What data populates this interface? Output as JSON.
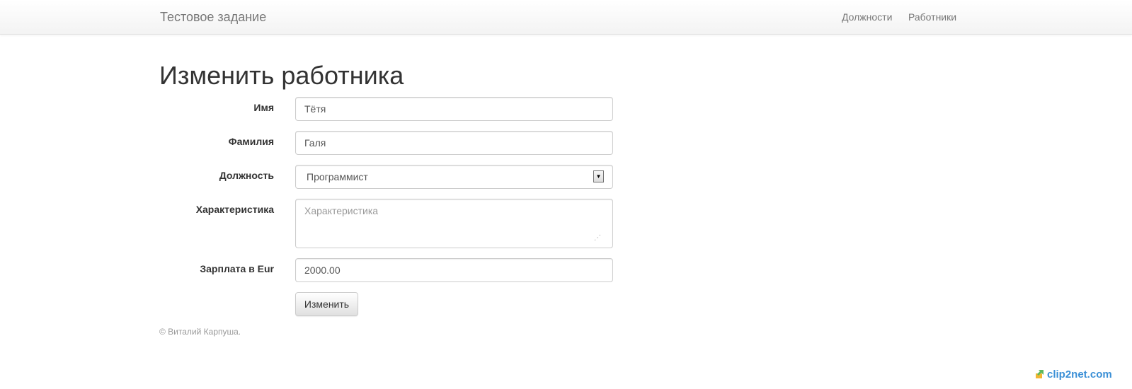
{
  "navbar": {
    "brand": "Тестовое задание",
    "links": [
      {
        "label": "Должности"
      },
      {
        "label": "Работники"
      }
    ]
  },
  "page": {
    "title": "Изменить работника"
  },
  "form": {
    "first_name": {
      "label": "Имя",
      "value": "Тётя"
    },
    "last_name": {
      "label": "Фамилия",
      "value": "Галя"
    },
    "position": {
      "label": "Должность",
      "value": "Программист"
    },
    "description": {
      "label": "Характеристика",
      "placeholder": "Характеристика",
      "value": ""
    },
    "salary": {
      "label": "Зарплата в Eur",
      "value": "2000.00"
    },
    "submit_label": "Изменить"
  },
  "footer": {
    "text": "© Виталий Карпуша."
  },
  "watermark": {
    "text": "clip2net.com",
    "icon": "clip2net-logo-icon"
  },
  "colors": {
    "navbar_bg": "#f8f8f8",
    "nav_text": "#777777",
    "text": "#333333",
    "muted": "#999999",
    "watermark": "#3a8fd6"
  }
}
